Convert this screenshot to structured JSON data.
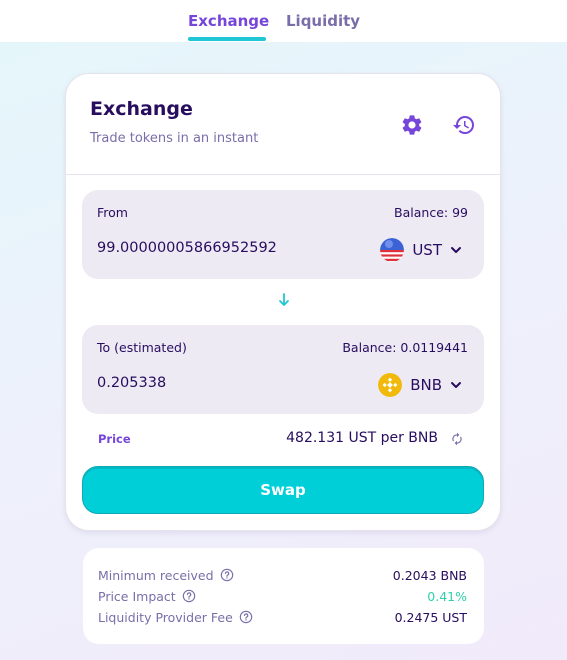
{
  "tabs": [
    {
      "label": "Exchange",
      "active": true
    },
    {
      "label": "Liquidity",
      "active": false
    }
  ],
  "card": {
    "title": "Exchange",
    "subtitle": "Trade tokens in an instant",
    "icons": {
      "settings": "gear-icon",
      "history": "history-clock-icon"
    }
  },
  "from": {
    "label": "From",
    "balance": "Balance: 99",
    "amount": "99.00000005866952592",
    "token": "UST",
    "token_icon": "ust-flag-icon"
  },
  "to": {
    "label": "To (estimated)",
    "balance": "Balance: 0.0119441",
    "amount": "0.205338",
    "token": "BNB",
    "token_icon": "bnb-icon"
  },
  "price": {
    "label": "Price",
    "value": "482.131 UST per BNB"
  },
  "swap_label": "Swap",
  "details": [
    {
      "name": "Minimum received",
      "value": "0.2043 BNB"
    },
    {
      "name": "Price Impact",
      "value": "0.41%"
    },
    {
      "name": "Liquidity Provider Fee",
      "value": "0.2475 UST"
    }
  ],
  "colors": {
    "accent": "#1fc7d4",
    "primary_text": "#280d5f",
    "secondary_text": "#7a6eaa",
    "purple": "#7645d9",
    "success": "#31d0aa",
    "panel_bg": "#eeeaf4"
  }
}
